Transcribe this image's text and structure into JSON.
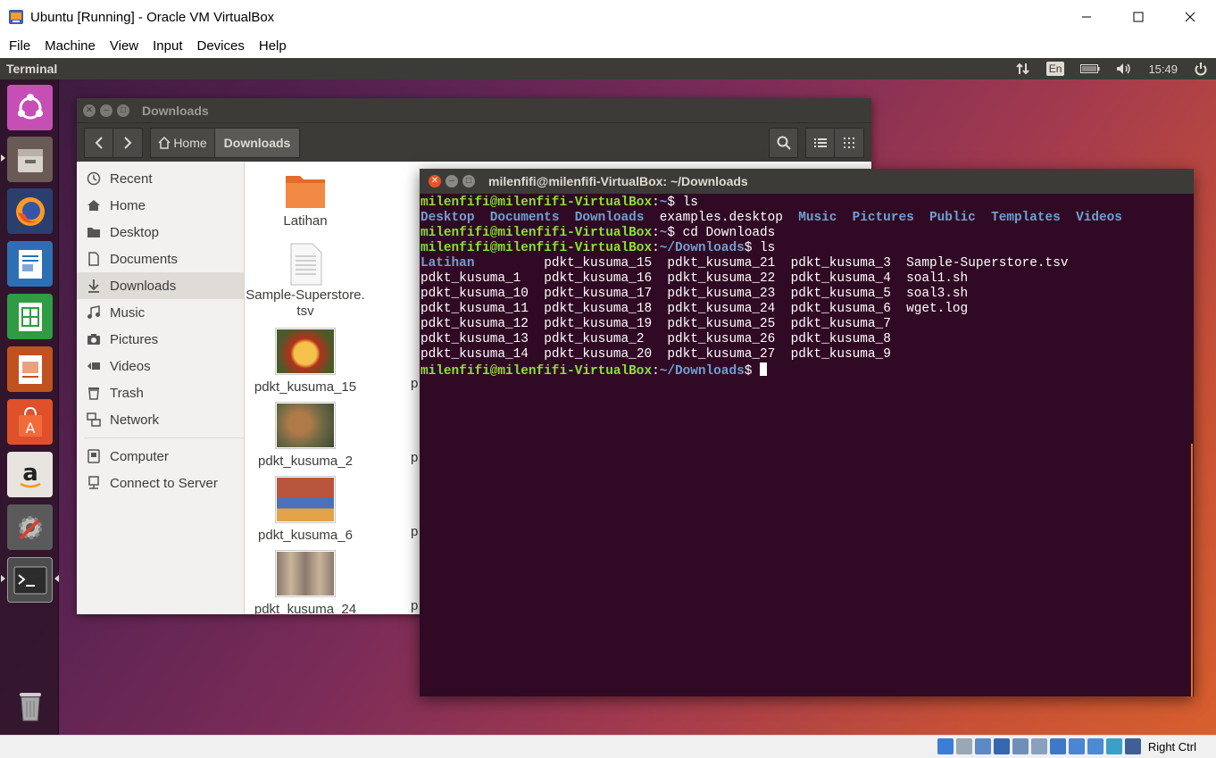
{
  "window": {
    "title": "Ubuntu [Running] - Oracle VM VirtualBox"
  },
  "menubar": {
    "items": [
      "File",
      "Machine",
      "View",
      "Input",
      "Devices",
      "Help"
    ]
  },
  "top_panel": {
    "app_name": "Terminal",
    "lang": "En",
    "time": "15:49"
  },
  "launcher": {
    "items": [
      {
        "name": "ubuntu-dash-icon"
      },
      {
        "name": "files-icon",
        "running": true
      },
      {
        "name": "firefox-icon"
      },
      {
        "name": "libreoffice-writer-icon"
      },
      {
        "name": "libreoffice-calc-icon"
      },
      {
        "name": "libreoffice-impress-icon"
      },
      {
        "name": "software-center-icon"
      },
      {
        "name": "amazon-icon"
      },
      {
        "name": "system-settings-icon"
      },
      {
        "name": "terminal-icon",
        "running": true,
        "active": true
      },
      {
        "name": "trash-icon"
      }
    ]
  },
  "nautilus": {
    "title": "Downloads",
    "breadcrumb": {
      "home": "Home",
      "current": "Downloads"
    },
    "sidebar": [
      {
        "label": "Recent",
        "icon": "clock-icon"
      },
      {
        "label": "Home",
        "icon": "home-icon"
      },
      {
        "label": "Desktop",
        "icon": "desktop-folder-icon"
      },
      {
        "label": "Documents",
        "icon": "document-icon"
      },
      {
        "label": "Downloads",
        "icon": "download-icon",
        "active": true
      },
      {
        "label": "Music",
        "icon": "music-icon"
      },
      {
        "label": "Pictures",
        "icon": "camera-icon"
      },
      {
        "label": "Videos",
        "icon": "video-icon"
      },
      {
        "label": "Trash",
        "icon": "trash-icon"
      },
      {
        "label": "Network",
        "icon": "network-icon"
      },
      {
        "label": "Computer",
        "icon": "computer-icon"
      },
      {
        "label": "Connect to Server",
        "icon": "server-icon"
      }
    ],
    "files": [
      {
        "name": "Latihan",
        "type": "folder"
      },
      {
        "name": "Sample-Superstore.\ntsv",
        "type": "text"
      },
      {
        "name": "pdkt_kusuma_15",
        "type": "image",
        "colors": [
          "#b3311c",
          "#f4c24a"
        ]
      },
      {
        "name": "pdkt_kusuma_2",
        "type": "image",
        "colors": [
          "#6e6a46",
          "#b07a48"
        ]
      },
      {
        "name": "pdkt_kusuma_6",
        "type": "image",
        "colors": [
          "#4d71b8",
          "#b8553d"
        ]
      },
      {
        "name": "pdkt_kusuma_24",
        "type": "image",
        "colors": [
          "#8a7a6e",
          "#c9b49a"
        ]
      }
    ],
    "partial_label": "p"
  },
  "terminal": {
    "title": "milenfifi@milenfifi-VirtualBox: ~/Downloads",
    "prompt_user": "milenfifi@milenfifi-VirtualBox",
    "home_path": "~",
    "dl_path": "~/Downloads",
    "cmd1": "ls",
    "home_listing": [
      {
        "text": "Desktop",
        "dir": true
      },
      {
        "text": "Documents",
        "dir": true
      },
      {
        "text": "Downloads",
        "dir": true
      },
      {
        "text": "examples.desktop",
        "dir": false
      },
      {
        "text": "Music",
        "dir": true
      },
      {
        "text": "Pictures",
        "dir": true
      },
      {
        "text": "Public",
        "dir": true
      },
      {
        "text": "Templates",
        "dir": true
      },
      {
        "text": "Videos",
        "dir": true
      }
    ],
    "cmd2": "cd Downloads",
    "cmd3": "ls",
    "dl_listing": [
      [
        {
          "text": "Latihan",
          "dir": true
        },
        {
          "text": "pdkt_kusuma_15"
        },
        {
          "text": "pdkt_kusuma_21"
        },
        {
          "text": "pdkt_kusuma_3"
        },
        {
          "text": "Sample-Superstore.tsv"
        }
      ],
      [
        {
          "text": "pdkt_kusuma_1"
        },
        {
          "text": "pdkt_kusuma_16"
        },
        {
          "text": "pdkt_kusuma_22"
        },
        {
          "text": "pdkt_kusuma_4"
        },
        {
          "text": "soal1.sh"
        }
      ],
      [
        {
          "text": "pdkt_kusuma_10"
        },
        {
          "text": "pdkt_kusuma_17"
        },
        {
          "text": "pdkt_kusuma_23"
        },
        {
          "text": "pdkt_kusuma_5"
        },
        {
          "text": "soal3.sh"
        }
      ],
      [
        {
          "text": "pdkt_kusuma_11"
        },
        {
          "text": "pdkt_kusuma_18"
        },
        {
          "text": "pdkt_kusuma_24"
        },
        {
          "text": "pdkt_kusuma_6"
        },
        {
          "text": "wget.log"
        }
      ],
      [
        {
          "text": "pdkt_kusuma_12"
        },
        {
          "text": "pdkt_kusuma_19"
        },
        {
          "text": "pdkt_kusuma_25"
        },
        {
          "text": "pdkt_kusuma_7"
        }
      ],
      [
        {
          "text": "pdkt_kusuma_13"
        },
        {
          "text": "pdkt_kusuma_2"
        },
        {
          "text": "pdkt_kusuma_26"
        },
        {
          "text": "pdkt_kusuma_8"
        }
      ],
      [
        {
          "text": "pdkt_kusuma_14"
        },
        {
          "text": "pdkt_kusuma_20"
        },
        {
          "text": "pdkt_kusuma_27"
        },
        {
          "text": "pdkt_kusuma_9"
        }
      ]
    ]
  },
  "status_bar": {
    "host_key": "Right Ctrl",
    "icons": [
      "hard-disk-icon",
      "optical-drive-icon",
      "audio-icon",
      "network-adapter-icon",
      "usb-icon",
      "shared-folders-icon",
      "display-icon",
      "video-capture-icon",
      "cpu-icon",
      "mouse-integration-icon",
      "keyboard-capture-icon"
    ]
  },
  "colors": {
    "prompt_user": "#8ae234",
    "prompt_path": "#729fcf",
    "terminal_bg": "#300a24",
    "panel": "#3c3b37"
  }
}
